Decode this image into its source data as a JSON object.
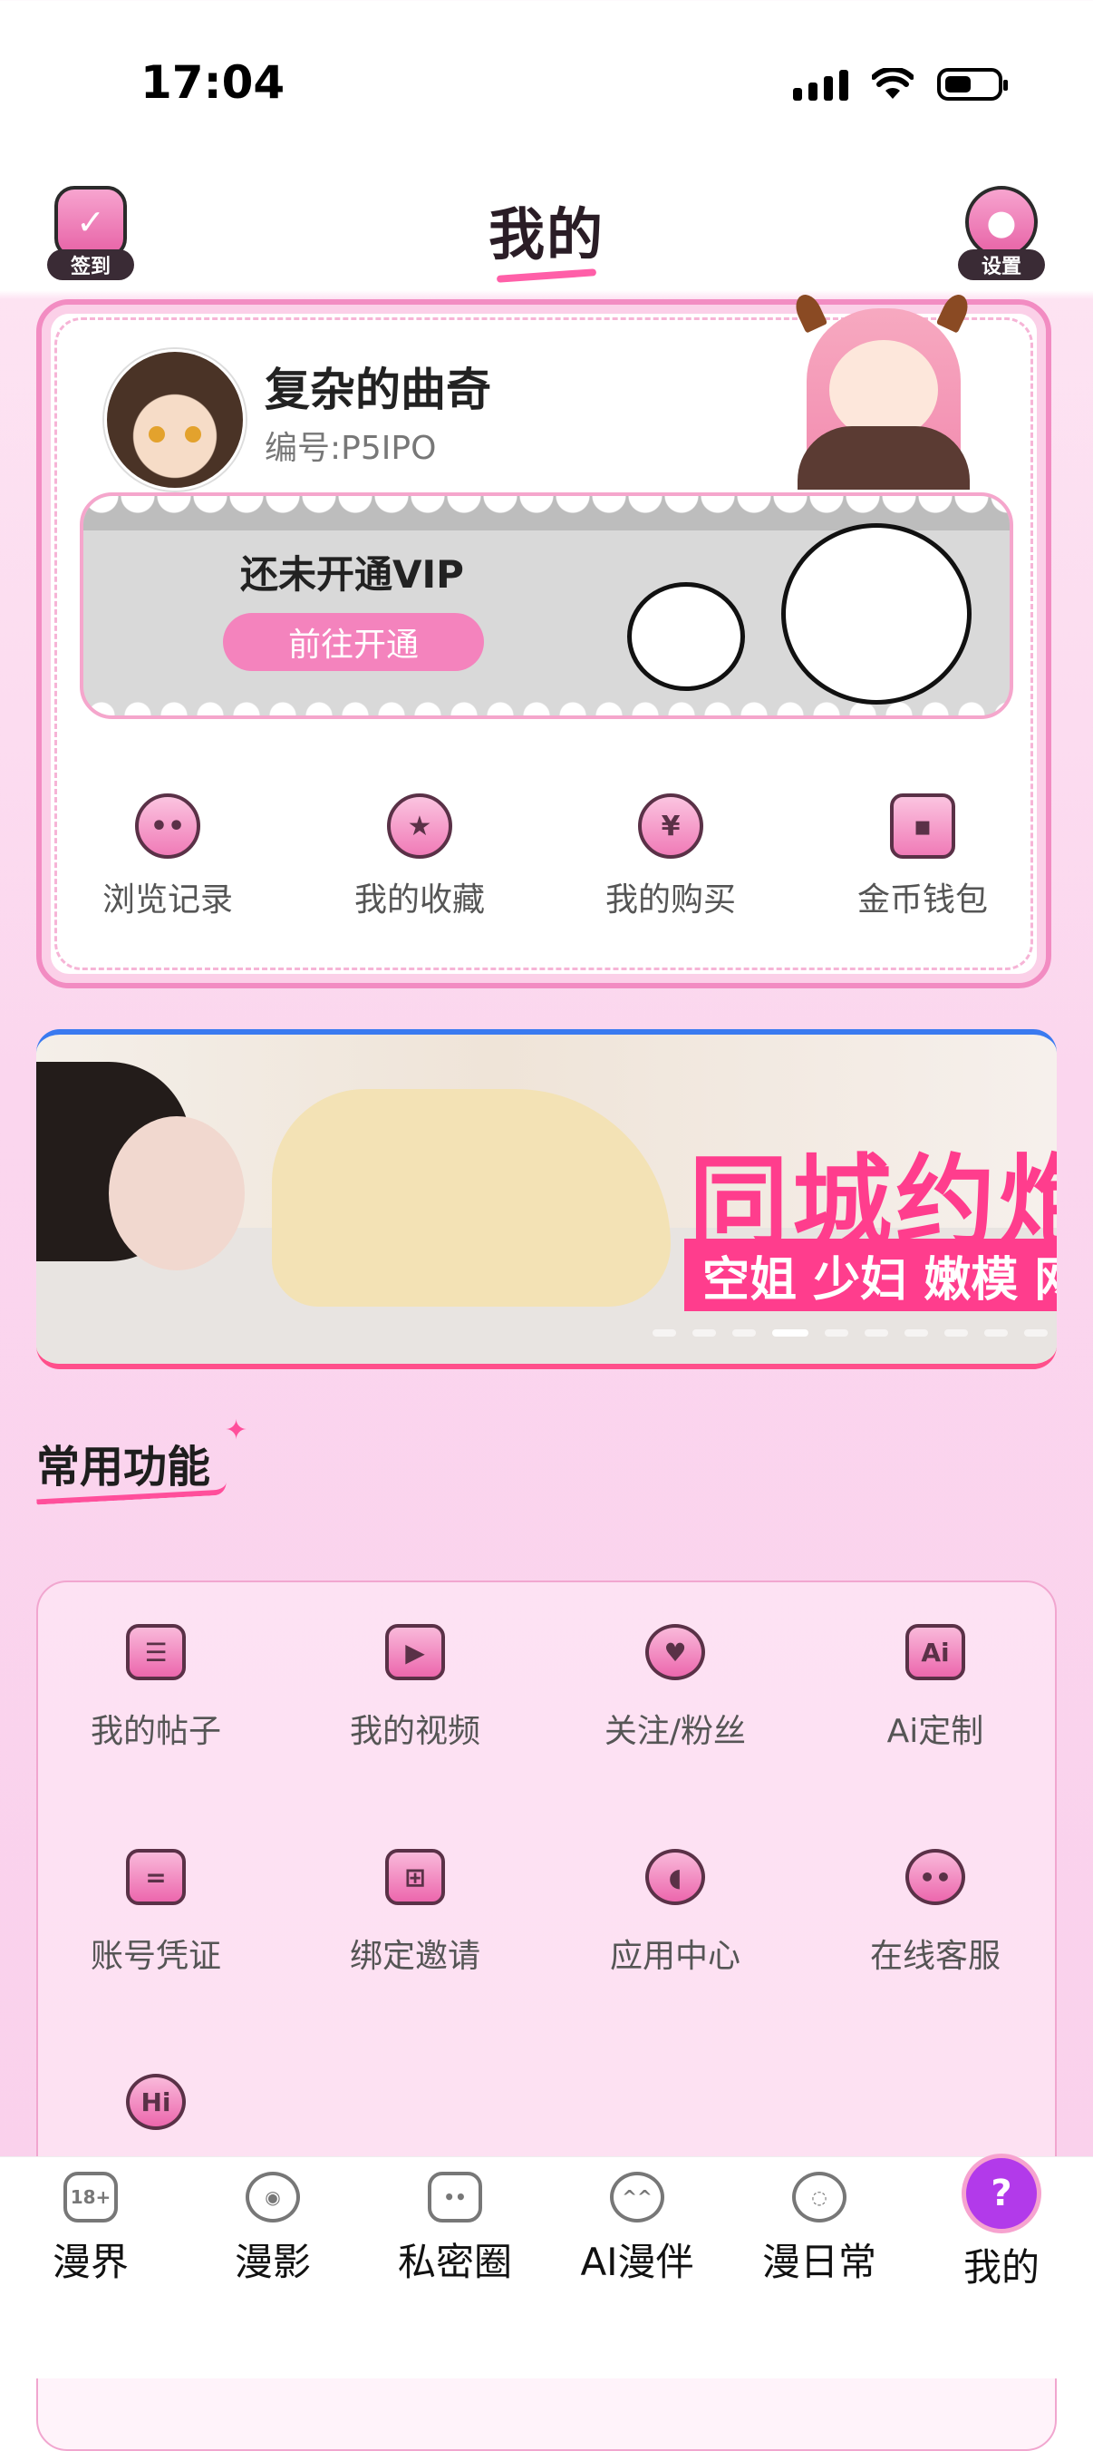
{
  "status_bar": {
    "time": "17:04"
  },
  "header": {
    "checkin_label": "签到",
    "title": "我的",
    "settings_label": "设置"
  },
  "profile": {
    "username": "复杂的曲奇",
    "user_id": "编号:P5IPO"
  },
  "vip": {
    "status_text": "还未开通VIP",
    "button_label": "前往开通"
  },
  "quick_links": [
    {
      "label": "浏览记录",
      "icon": "face-icon"
    },
    {
      "label": "我的收藏",
      "icon": "star-icon"
    },
    {
      "label": "我的购买",
      "icon": "yen-icon"
    },
    {
      "label": "金币钱包",
      "icon": "wallet-icon"
    }
  ],
  "ad_banner": {
    "headline": "同城约炮",
    "subline": "空姐 少妇 嫩模 网红",
    "slide_count": 10,
    "active_slide": 3
  },
  "functions": {
    "section_title": "常用功能",
    "items": [
      {
        "label": "我的帖子",
        "icon": "post-icon"
      },
      {
        "label": "我的视频",
        "icon": "video-camera-icon"
      },
      {
        "label": "关注/粉丝",
        "icon": "follow-heart-icon"
      },
      {
        "label": "Ai定制",
        "icon": "ai-icon"
      },
      {
        "label": "账号凭证",
        "icon": "ticket-icon"
      },
      {
        "label": "绑定邀请",
        "icon": "invite-icon"
      },
      {
        "label": "应用中心",
        "icon": "pacman-icon"
      },
      {
        "label": "在线客服",
        "icon": "chat-bubble-icon"
      },
      {
        "label": "",
        "icon": "hi-icon"
      }
    ]
  },
  "tabbar": {
    "items": [
      {
        "label": "漫界",
        "icon": "18plus-card-icon",
        "active": false
      },
      {
        "label": "漫影",
        "icon": "camera-icon",
        "active": false
      },
      {
        "label": "私密圈",
        "icon": "ghost-bag-icon",
        "active": false
      },
      {
        "label": "AI漫伴",
        "icon": "anime-face-icon",
        "active": false
      },
      {
        "label": "漫日常",
        "icon": "planet-icon",
        "active": false
      },
      {
        "label": "我的",
        "icon": "profile-ghost-icon",
        "active": true
      }
    ]
  },
  "colors": {
    "accent": "#f483bd",
    "active_tab": "#b23aea",
    "headline_pink": "#ff3d8d"
  }
}
